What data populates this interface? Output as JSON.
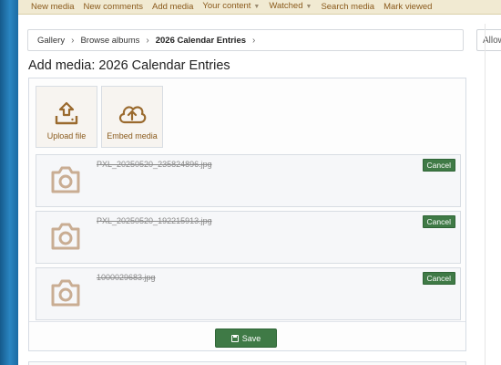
{
  "nav": {
    "items": [
      {
        "label": "New media",
        "has_caret": false
      },
      {
        "label": "New comments",
        "has_caret": false
      },
      {
        "label": "Add media",
        "has_caret": false
      },
      {
        "label": "Your content",
        "has_caret": true
      },
      {
        "label": "Watched",
        "has_caret": true
      },
      {
        "label": "Search media",
        "has_caret": false
      },
      {
        "label": "Mark viewed",
        "has_caret": false
      }
    ]
  },
  "breadcrumb": {
    "items": [
      "Gallery",
      "Browse albums",
      "2026 Calendar Entries"
    ]
  },
  "sidebar_button": {
    "label": "Allow"
  },
  "page": {
    "title": "Add media: 2026 Calendar Entries"
  },
  "actions": {
    "upload": {
      "label": "Upload file",
      "icon": "upload-icon"
    },
    "embed": {
      "label": "Embed media",
      "icon": "cloud-upload-icon"
    }
  },
  "files": [
    {
      "name": "PXL_20250520_235824896.jpg",
      "cancel_label": "Cancel",
      "icon": "camera-icon"
    },
    {
      "name": "PXL_20250520_192215913.jpg",
      "cancel_label": "Cancel",
      "icon": "camera-icon"
    },
    {
      "name": "1000029683.jpg",
      "cancel_label": "Cancel",
      "icon": "camera-icon"
    }
  ],
  "form": {
    "save_label": "Save"
  },
  "colors": {
    "accent_text": "#8a5a1c",
    "button_green": "#3f7a46",
    "nav_bg": "#f1ead2",
    "icon_tan": "#c9ad93",
    "side_blue": "#1d6aa5"
  }
}
